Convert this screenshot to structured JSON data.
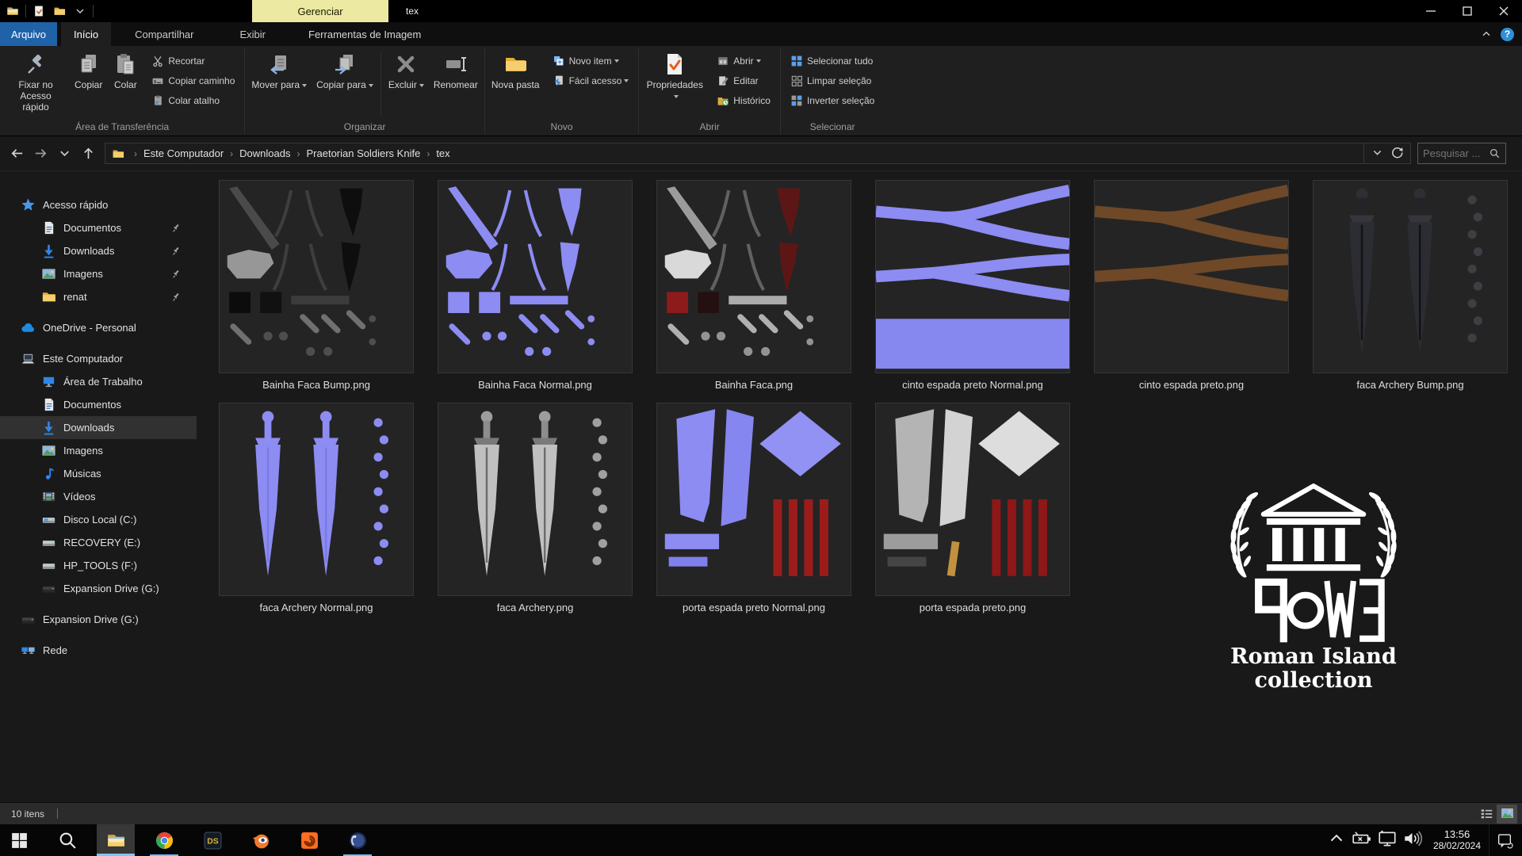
{
  "window": {
    "title": "tex",
    "context_tab": "Gerenciar",
    "controls": {
      "minimize": "minimize",
      "maximize": "maximize",
      "close": "close"
    }
  },
  "tabs": {
    "file_label": "Arquivo",
    "home": "Início",
    "share": "Compartilhar",
    "view": "Exibir",
    "contextual": "Ferramentas de Imagem",
    "selected": "Início",
    "help": "?"
  },
  "ribbon": {
    "groups": [
      {
        "label": "Área de Transferência",
        "cells": [
          {
            "kind": "big",
            "label": "Fixar no Acesso rápido",
            "icon": "pin"
          },
          {
            "kind": "big",
            "label": "Copiar",
            "icon": "copy"
          },
          {
            "kind": "big",
            "label": "Colar",
            "icon": "paste"
          },
          {
            "kind": "stack",
            "buttons": [
              {
                "label": "Recortar",
                "icon": "cut"
              },
              {
                "label": "Copiar caminho",
                "icon": "copy-path"
              },
              {
                "label": "Colar atalho",
                "icon": "paste-shortcut"
              }
            ]
          }
        ]
      },
      {
        "label": "Organizar",
        "cells": [
          {
            "kind": "big",
            "label": "Mover para",
            "icon": "move-to",
            "dropdown": true
          },
          {
            "kind": "big",
            "label": "Copiar para",
            "icon": "copy-to",
            "dropdown": true
          },
          {
            "kind": "divider"
          },
          {
            "kind": "big",
            "label": "Excluir",
            "icon": "delete",
            "dropdown": true
          },
          {
            "kind": "big",
            "label": "Renomear",
            "icon": "rename"
          }
        ]
      },
      {
        "label": "Novo",
        "cells": [
          {
            "kind": "big",
            "label": "Nova pasta",
            "icon": "new-folder"
          },
          {
            "kind": "stack",
            "buttons": [
              {
                "label": "Novo item",
                "icon": "new-item",
                "dropdown": true
              },
              {
                "label": "Fácil acesso",
                "icon": "easy-access",
                "dropdown": true
              }
            ]
          }
        ]
      },
      {
        "label": "Abrir",
        "cells": [
          {
            "kind": "big",
            "label": "Propriedades",
            "icon": "properties",
            "dropdown": true
          },
          {
            "kind": "stack",
            "buttons": [
              {
                "label": "Abrir",
                "icon": "open",
                "dropdown": true
              },
              {
                "label": "Editar",
                "icon": "edit"
              },
              {
                "label": "Histórico",
                "icon": "history"
              }
            ]
          }
        ]
      },
      {
        "label": "Selecionar",
        "cells": [
          {
            "kind": "stack",
            "buttons": [
              {
                "label": "Selecionar tudo",
                "icon": "select-all"
              },
              {
                "label": "Limpar seleção",
                "icon": "select-none"
              },
              {
                "label": "Inverter seleção",
                "icon": "invert-selection"
              }
            ]
          }
        ]
      }
    ]
  },
  "address": {
    "nav": [
      {
        "name": "back",
        "icon": "back"
      },
      {
        "name": "forward",
        "icon": "forward"
      },
      {
        "name": "recent",
        "icon": "chevron-down-sm"
      },
      {
        "name": "up",
        "icon": "up"
      }
    ],
    "breadcrumb_icon": "folder-small",
    "path": [
      "Este Computador",
      "Downloads",
      "Praetorian Soldiers Knife",
      "tex"
    ],
    "actions": [
      {
        "name": "address-dropdown",
        "icon": "chevron-down-sm"
      },
      {
        "name": "refresh",
        "icon": "refresh"
      }
    ]
  },
  "search": {
    "placeholder": "Pesquisar ...",
    "icon": "search"
  },
  "sidebar": {
    "items": [
      {
        "label": "Acesso rápido",
        "icon": "star",
        "level": 0
      },
      {
        "label": "Documentos",
        "icon": "document",
        "level": 1,
        "pinned": true
      },
      {
        "label": "Downloads",
        "icon": "download",
        "level": 1,
        "pinned": true
      },
      {
        "label": "Imagens",
        "icon": "picture",
        "level": 1,
        "pinned": true
      },
      {
        "label": "renat",
        "icon": "folder",
        "level": 1,
        "pinned": true
      },
      {
        "label": "OneDrive - Personal",
        "icon": "cloud",
        "level": 0,
        "spacer": true
      },
      {
        "label": "Este Computador",
        "icon": "computer",
        "level": 0,
        "spacer": true
      },
      {
        "label": "Área de Trabalho",
        "icon": "desktop",
        "level": 1
      },
      {
        "label": "Documentos",
        "icon": "document",
        "level": 1
      },
      {
        "label": "Downloads",
        "icon": "download",
        "level": 1,
        "selected": true
      },
      {
        "label": "Imagens",
        "icon": "picture",
        "level": 1
      },
      {
        "label": "Músicas",
        "icon": "music",
        "level": 1
      },
      {
        "label": "Vídeos",
        "icon": "video",
        "level": 1
      },
      {
        "label": "Disco Local (C:)",
        "icon": "drive-os",
        "level": 1
      },
      {
        "label": "RECOVERY (E:)",
        "icon": "drive",
        "level": 1
      },
      {
        "label": "HP_TOOLS (F:)",
        "icon": "drive",
        "level": 1
      },
      {
        "label": "Expansion Drive (G:)",
        "icon": "drive-ext",
        "level": 1
      },
      {
        "label": "Expansion Drive (G:)",
        "icon": "drive-ext",
        "level": 0,
        "spacer": true
      },
      {
        "label": "Rede",
        "icon": "network",
        "level": 0,
        "spacer": true
      }
    ]
  },
  "files": [
    {
      "name": "Bainha Faca Bump.png",
      "thumb": "bainha",
      "variant": "bump"
    },
    {
      "name": "Bainha Faca Normal.png",
      "thumb": "bainha",
      "variant": "normal"
    },
    {
      "name": "Bainha Faca.png",
      "thumb": "bainha",
      "variant": "diffuse"
    },
    {
      "name": "cinto espada preto Normal.png",
      "thumb": "cinto",
      "variant": "normal"
    },
    {
      "name": "cinto espada preto.png",
      "thumb": "cinto",
      "variant": "diffuse"
    },
    {
      "name": "faca Archery Bump.png",
      "thumb": "faca",
      "variant": "bump"
    },
    {
      "name": "faca Archery Normal.png",
      "thumb": "faca",
      "variant": "normal"
    },
    {
      "name": "faca Archery.png",
      "thumb": "faca",
      "variant": "diffuse"
    },
    {
      "name": "porta espada preto Normal.png",
      "thumb": "porta",
      "variant": "normal"
    },
    {
      "name": "porta espada preto.png",
      "thumb": "porta",
      "variant": "diffuse"
    }
  ],
  "logo": {
    "word": "ROME",
    "line1": "Roman Island",
    "line2": "collection"
  },
  "status_bar": {
    "items_count": "10 itens"
  },
  "taskbar": {
    "buttons": [
      {
        "name": "start",
        "icon": "start"
      },
      {
        "name": "taskbar-search",
        "icon": "tb-search"
      },
      {
        "name": "file-explorer",
        "icon": "tb-explorer",
        "active": true,
        "running": true
      },
      {
        "name": "chrome",
        "icon": "chrome",
        "running": true
      },
      {
        "name": "daz-studio",
        "icon": "daz"
      },
      {
        "name": "blender",
        "icon": "blender"
      },
      {
        "name": "houdini",
        "icon": "houdini"
      },
      {
        "name": "cinema4d",
        "icon": "c4d",
        "running": true
      }
    ],
    "tray_icons": [
      {
        "name": "tray-expand",
        "icon": "chevron-up"
      },
      {
        "name": "battery",
        "icon": "battery"
      },
      {
        "name": "display",
        "icon": "display"
      },
      {
        "name": "volume",
        "icon": "volume"
      }
    ],
    "time": "13:56",
    "date": "28/02/2024",
    "action_center": {
      "icon": "action"
    }
  },
  "colors": {
    "normal_map_lavender": "#8c8cf2",
    "context_tab_yellow": "#ece9a2",
    "file_tab_blue": "#1f62a8",
    "accent_underline": "#6cc1ff",
    "dark_red": "#8e1717",
    "belt_brown": "#6f4827",
    "gold": "#c2913e"
  }
}
